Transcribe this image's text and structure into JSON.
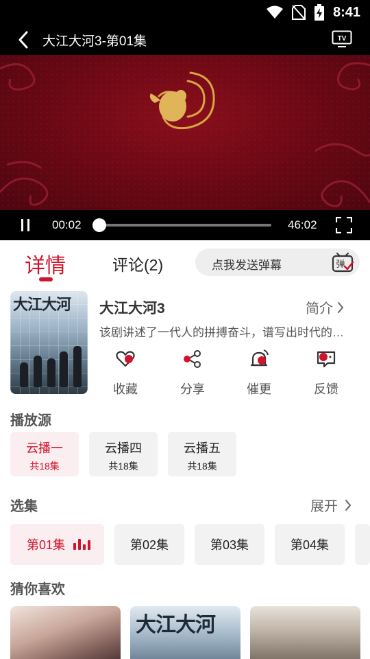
{
  "status": {
    "time": "8:41"
  },
  "player": {
    "title": "大江大河3-第01集",
    "current_time": "00:02",
    "total_time": "46:02",
    "progress": 0.02
  },
  "tabs": {
    "detail": "详情",
    "comments": "评论(2)",
    "danmaku_placeholder": "点我发送弹幕",
    "danmaku_icon_text": "弹"
  },
  "info": {
    "poster_title": "大江大河",
    "show_title": "大江大河3",
    "intro_label": "简介",
    "synopsis": "该剧讲述了一代人的拼搏奋斗，谱写出时代的…"
  },
  "actions": [
    {
      "label": "收藏",
      "icon": "heart-icon"
    },
    {
      "label": "分享",
      "icon": "share-icon"
    },
    {
      "label": "催更",
      "icon": "bell-icon"
    },
    {
      "label": "反馈",
      "icon": "feedback-icon"
    }
  ],
  "sources": {
    "label": "播放源",
    "items": [
      {
        "name": "云播一",
        "count": "共18集",
        "active": true
      },
      {
        "name": "云播四",
        "count": "共18集",
        "active": false
      },
      {
        "name": "云播五",
        "count": "共18集",
        "active": false
      }
    ]
  },
  "episodes": {
    "label": "选集",
    "expand_label": "展开",
    "items": [
      "第01集",
      "第02集",
      "第03集",
      "第04集"
    ],
    "active_index": 0
  },
  "recommend": {
    "label": "猜你喜欢"
  },
  "colors": {
    "accent": "#d0142c",
    "player_bg": "#000000",
    "video_red": "#6e0915"
  }
}
